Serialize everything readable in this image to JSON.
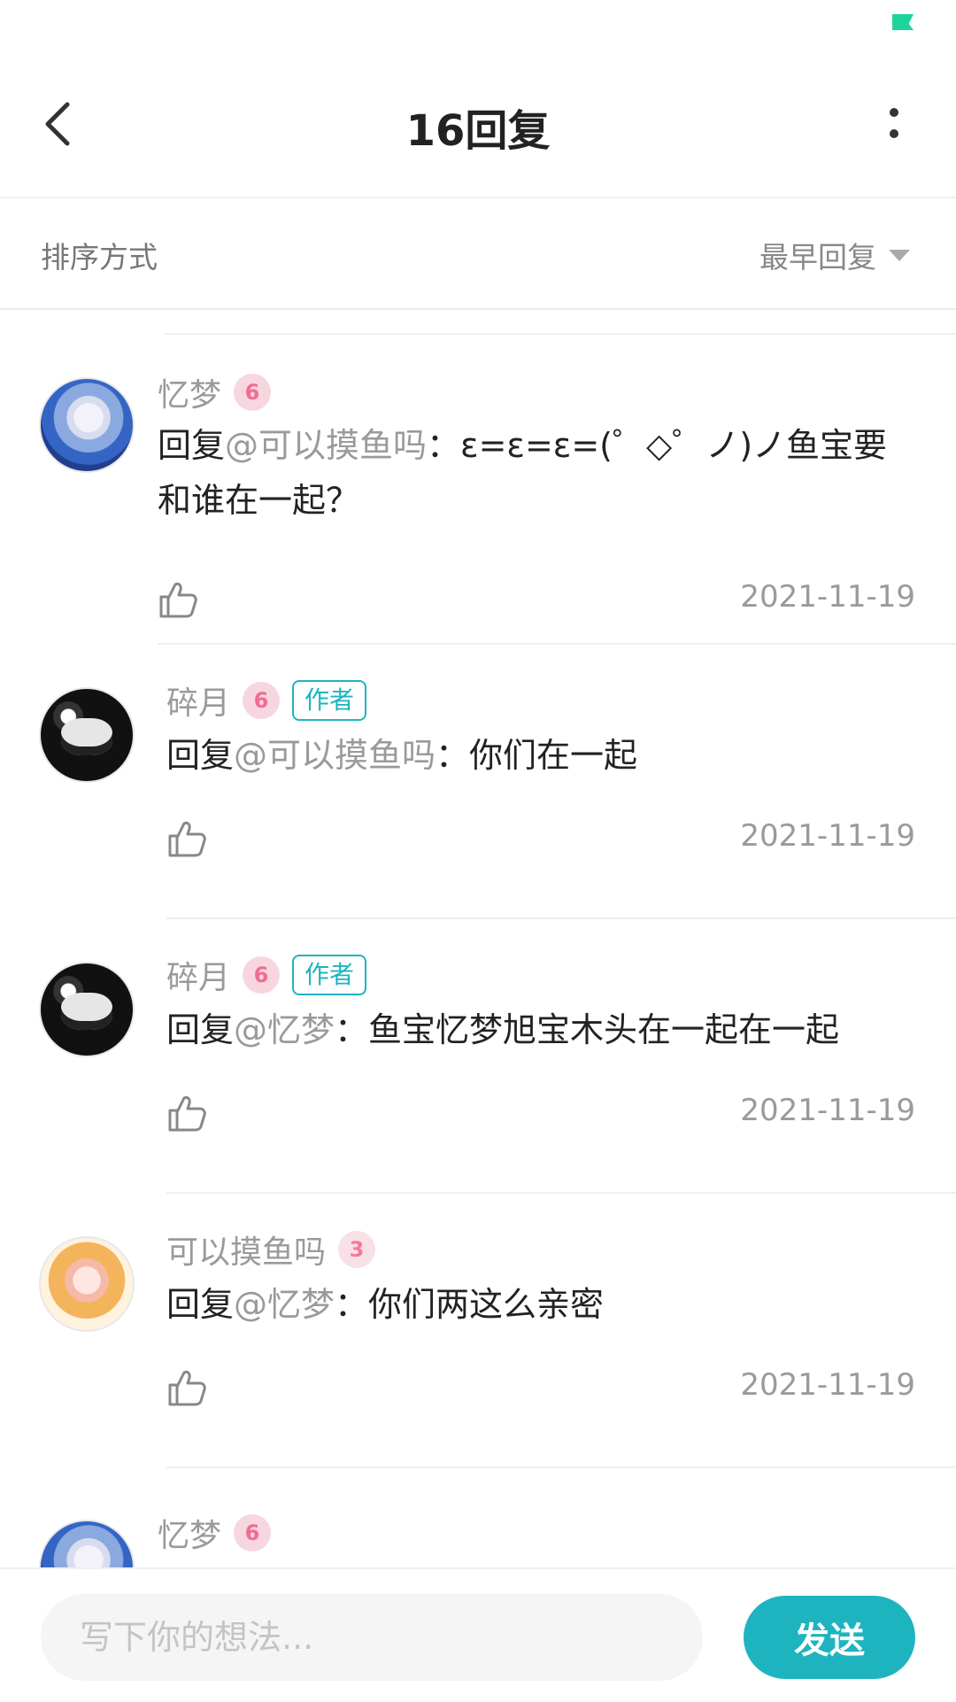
{
  "header": {
    "title": "16回复"
  },
  "sort": {
    "label": "排序方式",
    "selected": "最早回复"
  },
  "replies": [
    {
      "username": "忆梦",
      "level": "6",
      "author_tag": "",
      "prefix": "回复",
      "mention": "@可以摸鱼吗",
      "text": "：ε=ε=ε=(゜◇゜ノ)ノ鱼宝要和谁在一起？",
      "date": "2021-11-19"
    },
    {
      "username": "碎月",
      "level": "6",
      "author_tag": "作者",
      "prefix": "回复",
      "mention": "@可以摸鱼吗",
      "text": "：你们在一起",
      "date": "2021-11-19"
    },
    {
      "username": "碎月",
      "level": "6",
      "author_tag": "作者",
      "prefix": "回复",
      "mention": "@忆梦",
      "text": "：鱼宝忆梦旭宝木头在一起在一起",
      "date": "2021-11-19"
    },
    {
      "username": "可以摸鱼吗",
      "level": "3",
      "author_tag": "",
      "prefix": "回复",
      "mention": "@忆梦",
      "text": "：你们两这么亲密",
      "date": "2021-11-19"
    },
    {
      "username": "忆梦",
      "level": "6"
    }
  ],
  "composer": {
    "placeholder": "写下你的想法...",
    "send_label": "发送"
  },
  "colors": {
    "accent": "#1db4c0",
    "level_badge": "#f06b95",
    "status": "#1fd39c"
  }
}
